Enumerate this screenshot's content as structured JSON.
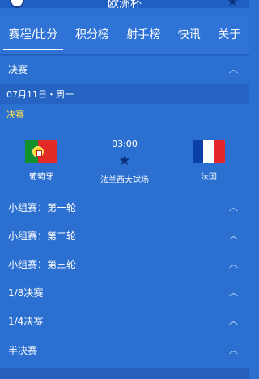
{
  "header": {
    "title": "欧洲杯",
    "avatar_icon": "avatar-icon",
    "favorite_icon": "star-icon"
  },
  "tabs": [
    {
      "label": "赛程/比分",
      "active": true
    },
    {
      "label": "积分榜",
      "active": false
    },
    {
      "label": "射手榜",
      "active": false
    },
    {
      "label": "快讯",
      "active": false
    },
    {
      "label": "关于",
      "active": false
    }
  ],
  "final_section": {
    "label": "决赛",
    "chevron": "chevron-up-icon",
    "date": "07月11日・周一",
    "stage": "决赛",
    "match": {
      "time": "03:00",
      "venue": "法兰西大球场",
      "home": {
        "name": "葡萄牙",
        "flag": "portugal-flag"
      },
      "away": {
        "name": "法国",
        "flag": "france-flag"
      },
      "favorite_icon": "star-icon"
    }
  },
  "rounds": [
    {
      "label": "小组赛：第一轮"
    },
    {
      "label": "小组赛：第二轮"
    },
    {
      "label": "小组赛：第三轮"
    },
    {
      "label": "1/8决赛"
    },
    {
      "label": "1/4决赛"
    },
    {
      "label": "半决赛"
    }
  ],
  "colors": {
    "background": "#2b6fd0",
    "stage_text": "#ffe64d",
    "star": "#0c2f7a",
    "france_blue": "#0d3fa8",
    "france_white": "#ffffff",
    "france_red": "#e3262b"
  }
}
